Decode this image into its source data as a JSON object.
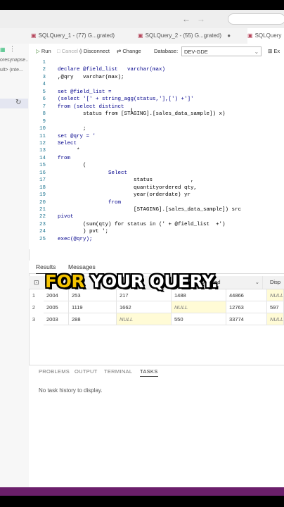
{
  "tabs": [
    {
      "label": "SQLQuery_1 - (77) G...grated)"
    },
    {
      "label": "SQLQuery_2 - (55) G...grated)"
    },
    {
      "label": "SQLQuery"
    }
  ],
  "left_panel": {
    "item1": "oresynapse...",
    "item2": "ult> (inte..."
  },
  "toolbar": {
    "run": "Run",
    "cancel": "Cancel",
    "disconnect": "Disconnect",
    "change": "Change",
    "database_label": "Database:",
    "database_value": "DEV-GDE",
    "extra": "Ex"
  },
  "editor": {
    "line_numbers": [
      "1",
      "2",
      "3",
      "4",
      "5",
      "6",
      "7",
      "8",
      "9",
      "10",
      "11",
      "12",
      "13",
      "14",
      "15",
      "16",
      "17",
      "18",
      "19",
      "20",
      "21",
      "22",
      "23",
      "24",
      "25"
    ],
    "lines": [
      "",
      "declare @field_list   varchar(max)",
      ",@qry   varchar(max);",
      "",
      "set @field_list =",
      "(select '[' + string_agg(status,'],[') +']'",
      "from (select distinct",
      "        status from [STAGING].[sales_data_sample]) x)",
      "",
      "        ;",
      "set @qry = '",
      "Select",
      "      *",
      "from",
      "        (",
      "                Select",
      "                        status            ,",
      "                        quantityordered qty,",
      "                        year(orderdate) yr",
      "                from",
      "                        [STAGING].[sales_data_sample]) src",
      "pivot",
      "        (sum(qty) for status in (' + @field_list  +')",
      "        ) pvt ';",
      "exec(@qry);"
    ]
  },
  "results": {
    "tab_results": "Results",
    "tab_messages": "Messages",
    "col_shipped": "Shipped",
    "col_disputed": "Disp",
    "rows": [
      {
        "num": "1",
        "yr": "2004",
        "c2": "253",
        "c3": "217",
        "c4": "1488",
        "shipped": "44866",
        "disp": "NULL"
      },
      {
        "num": "2",
        "yr": "2005",
        "c2": "1119",
        "c3": "1662",
        "c4": "NULL",
        "shipped": "12763",
        "disp": "597"
      },
      {
        "num": "3",
        "yr": "2003",
        "c2": "288",
        "c3": "NULL",
        "c4": "550",
        "shipped": "33774",
        "disp": "NULL"
      }
    ]
  },
  "bottom_panel": {
    "tabs": [
      "PROBLEMS",
      "OUTPUT",
      "TERMINAL",
      "TASKS"
    ],
    "message": "No task history to display."
  },
  "caption": {
    "word1": "FOR",
    "word2": "YOUR QUERY."
  }
}
